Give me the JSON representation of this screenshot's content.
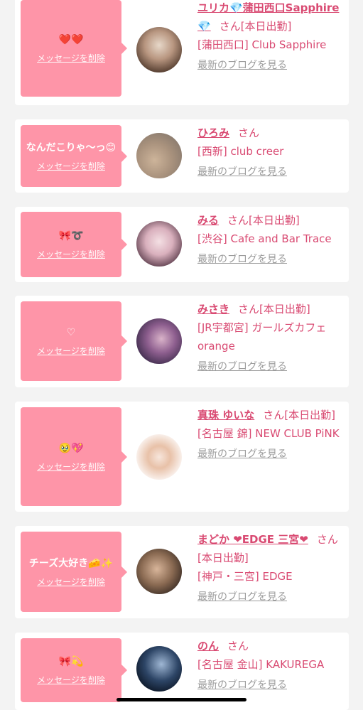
{
  "delete_label": "メッセージを削除",
  "blog_label": "最新のブログを見る",
  "honorific": "さん",
  "status": "[本日出勤]",
  "colors": {
    "bubble": "#fe95a8",
    "text_accent": "#d94a72",
    "link_gray": "#9c9c9c"
  },
  "cards": [
    {
      "message": "❤️❤️",
      "name": "ユリカ💎蒲田西口Sapphire💎",
      "status": "[本日出勤]",
      "shop": "[蒲田西口] Club Sapphire"
    },
    {
      "message": "なんだこりゃ〜っ😊",
      "name": "ひろみ",
      "status": "",
      "shop": "[西新] club creer"
    },
    {
      "message": "🎀➰",
      "name": "みる",
      "status": "[本日出勤]",
      "shop": "[渋谷] Cafe and Bar Trace"
    },
    {
      "message": "♡",
      "name": "みさき",
      "status": "[本日出勤]",
      "shop": "[JR宇都宮] ガールズカフェ orange"
    },
    {
      "message": "🥹💖",
      "name": "真珠 ゆいな",
      "status": "[本日出勤]",
      "shop": "[名古屋 錦] NEW CLUB PiNK"
    },
    {
      "message": "チーズ大好き🧀✨",
      "name": "まどか ❤EDGE 三宮❤",
      "status": "[本日出勤]",
      "shop": "[神戸・三宮] EDGE"
    },
    {
      "message": "🎀💫",
      "name": "のん",
      "status": "",
      "shop": "[名古屋 金山] KAKUREGA"
    }
  ]
}
